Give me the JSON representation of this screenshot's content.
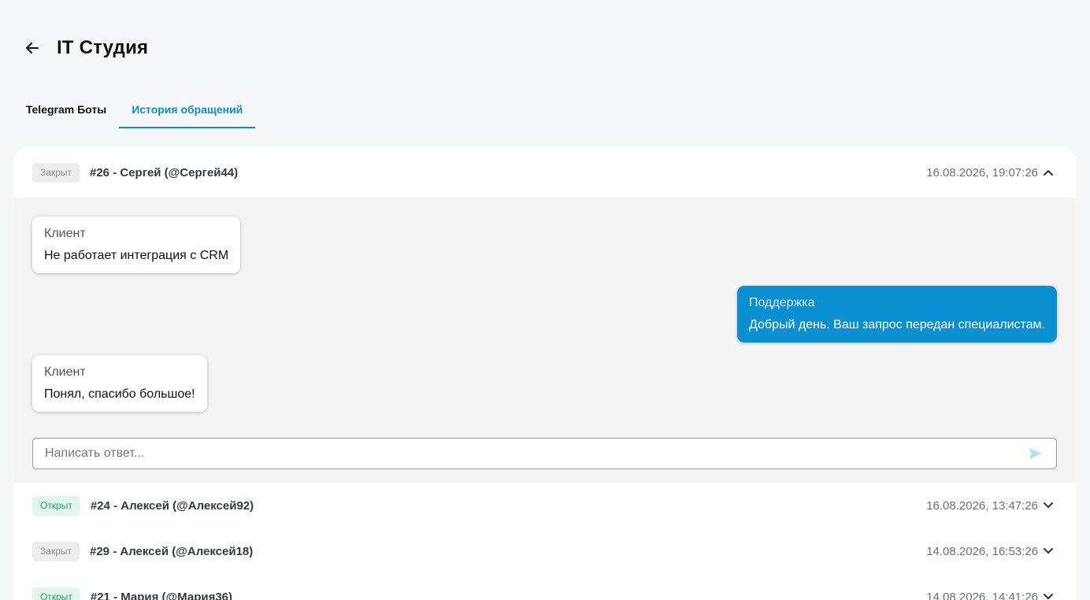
{
  "header": {
    "title": "IT Студия",
    "back_icon": "arrow-left-icon"
  },
  "tabs": [
    {
      "label": "Telegram Боты",
      "active": false
    },
    {
      "label": "История обращений",
      "active": true
    }
  ],
  "tickets": [
    {
      "status": "Закрыт",
      "title": "#26 - Сергей (@Сергей44)",
      "date": "16.08.2026, 19:07:26",
      "expanded": true,
      "messages": [
        {
          "author": "Клиент",
          "text": "Не работает интеграция с CRM",
          "side": "client"
        },
        {
          "author": "Поддержка",
          "text": "Добрый день. Ваш запрос передан специалистам.",
          "side": "support"
        },
        {
          "author": "Клиент",
          "text": "Понял, спасибо большое!",
          "side": "client"
        }
      ],
      "reply_placeholder": "Написать ответ..."
    },
    {
      "status": "Открыт",
      "title": "#24 - Алексей (@Алексей92)",
      "date": "16.08.2026, 13:47:26",
      "expanded": false
    },
    {
      "status": "Закрыт",
      "title": "#29 - Алексей (@Алексей18)",
      "date": "14.08.2026, 16:53:26",
      "expanded": false
    },
    {
      "status": "Открыт",
      "title": "#21 - Мария (@Мария36)",
      "date": "14.08.2026, 14:41:26",
      "expanded": false
    }
  ],
  "colors": {
    "accent": "#0a8fd1",
    "open_badge_text": "#21a366",
    "open_badge_bg": "#e3f6ec",
    "closed_badge_text": "#8e8e8e",
    "closed_badge_bg": "#ededed"
  },
  "icons": {
    "send": "send-icon",
    "chevron_up": "chevron-up-icon",
    "chevron_down": "chevron-down-icon"
  }
}
